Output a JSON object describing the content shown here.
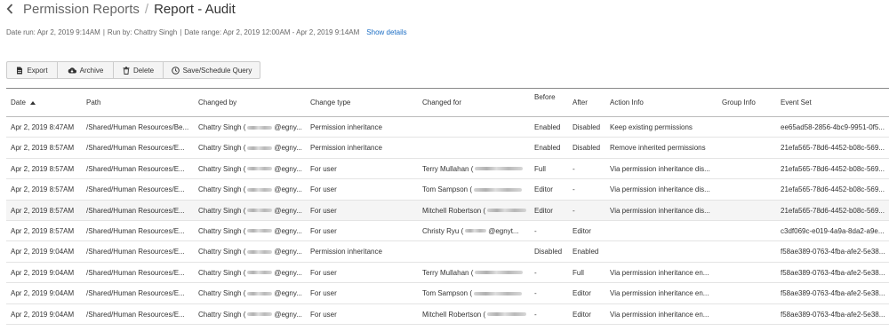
{
  "breadcrumb": {
    "parent": "Permission Reports",
    "separator": "/",
    "current": "Report - Audit"
  },
  "meta": {
    "date_run": "Date run: Apr 2, 2019 9:14AM",
    "run_by": "Run by: Chattry Singh",
    "date_range": "Date range: Apr 2, 2019 12:00AM - Apr 2, 2019 9:14AM",
    "separator": "|",
    "show_details": "Show details"
  },
  "toolbar": {
    "export": "Export",
    "archive": "Archive",
    "delete": "Delete",
    "schedule": "Save/Schedule Query"
  },
  "columns": {
    "date": "Date",
    "path": "Path",
    "changed_by": "Changed by",
    "change_type": "Change type",
    "changed_for": "Changed for",
    "before": "Before",
    "after": "After",
    "action_info": "Action Info",
    "group_info": "Group Info",
    "event_set": "Event Set"
  },
  "rows": [
    {
      "date": "Apr 2, 2019 8:47AM",
      "path": "/Shared/Human Resources/Be...",
      "changed_by_name": "Chattry Singh (",
      "changed_by_domain": "@egny...",
      "change_type": "Permission inheritance",
      "changed_for_name": "",
      "changed_for_domain": "",
      "before": "Enabled",
      "after": "Disabled",
      "action_info": "Keep existing permissions",
      "group_info": "",
      "event_set": "ee65ad58-2856-4bc9-9951-0f5..."
    },
    {
      "date": "Apr 2, 2019 8:57AM",
      "path": "/Shared/Human Resources/E...",
      "changed_by_name": "Chattry Singh (",
      "changed_by_domain": "@egny...",
      "change_type": "Permission inheritance",
      "changed_for_name": "",
      "changed_for_domain": "",
      "before": "Enabled",
      "after": "Disabled",
      "action_info": "Remove inherited permissions",
      "group_info": "",
      "event_set": "21efa565-78d6-4452-b08c-569..."
    },
    {
      "date": "Apr 2, 2019 8:57AM",
      "path": "/Shared/Human Resources/E...",
      "changed_by_name": "Chattry Singh (",
      "changed_by_domain": "@egny...",
      "change_type": "For user",
      "changed_for_name": "Terry Mullahan (",
      "changed_for_domain": "",
      "before": "Full",
      "after": "-",
      "action_info": "Via permission inheritance dis...",
      "group_info": "",
      "event_set": "21efa565-78d6-4452-b08c-569..."
    },
    {
      "date": "Apr 2, 2019 8:57AM",
      "path": "/Shared/Human Resources/E...",
      "changed_by_name": "Chattry Singh (",
      "changed_by_domain": "@egny...",
      "change_type": "For user",
      "changed_for_name": "Tom Sampson (",
      "changed_for_domain": "",
      "before": "Editor",
      "after": "-",
      "action_info": "Via permission inheritance dis...",
      "group_info": "",
      "event_set": "21efa565-78d6-4452-b08c-569..."
    },
    {
      "date": "Apr 2, 2019 8:57AM",
      "path": "/Shared/Human Resources/E...",
      "changed_by_name": "Chattry Singh (",
      "changed_by_domain": "@egny...",
      "change_type": "For user",
      "changed_for_name": "Mitchell Robertson (",
      "changed_for_domain": "",
      "before": "Editor",
      "after": "-",
      "action_info": "Via permission inheritance dis...",
      "group_info": "",
      "event_set": "21efa565-78d6-4452-b08c-569..."
    },
    {
      "date": "Apr 2, 2019 8:57AM",
      "path": "/Shared/Human Resources/E...",
      "changed_by_name": "Chattry Singh (",
      "changed_by_domain": "@egny...",
      "change_type": "For user",
      "changed_for_name": "Christy Ryu (",
      "changed_for_domain": "@egnyt...",
      "before": "-",
      "after": "Editor",
      "action_info": "",
      "group_info": "",
      "event_set": "c3df069c-e019-4a9a-8da2-a9e..."
    },
    {
      "date": "Apr 2, 2019 9:04AM",
      "path": "/Shared/Human Resources/E...",
      "changed_by_name": "Chattry Singh (",
      "changed_by_domain": "@egny...",
      "change_type": "Permission inheritance",
      "changed_for_name": "",
      "changed_for_domain": "",
      "before": "Disabled",
      "after": "Enabled",
      "action_info": "",
      "group_info": "",
      "event_set": "f58ae389-0763-4fba-afe2-5e38..."
    },
    {
      "date": "Apr 2, 2019 9:04AM",
      "path": "/Shared/Human Resources/E...",
      "changed_by_name": "Chattry Singh (",
      "changed_by_domain": "@egny...",
      "change_type": "For user",
      "changed_for_name": "Terry Mullahan (",
      "changed_for_domain": "",
      "before": "-",
      "after": "Full",
      "action_info": "Via permission inheritance en...",
      "group_info": "",
      "event_set": "f58ae389-0763-4fba-afe2-5e38..."
    },
    {
      "date": "Apr 2, 2019 9:04AM",
      "path": "/Shared/Human Resources/E...",
      "changed_by_name": "Chattry Singh (",
      "changed_by_domain": "@egny...",
      "change_type": "For user",
      "changed_for_name": "Tom Sampson (",
      "changed_for_domain": "",
      "before": "-",
      "after": "Editor",
      "action_info": "Via permission inheritance en...",
      "group_info": "",
      "event_set": "f58ae389-0763-4fba-afe2-5e38..."
    },
    {
      "date": "Apr 2, 2019 9:04AM",
      "path": "/Shared/Human Resources/E...",
      "changed_by_name": "Chattry Singh (",
      "changed_by_domain": "@egny...",
      "change_type": "For user",
      "changed_for_name": "Mitchell Robertson (",
      "changed_for_domain": "",
      "before": "-",
      "after": "Editor",
      "action_info": "Via permission inheritance en...",
      "group_info": "",
      "event_set": "f58ae389-0763-4fba-afe2-5e38..."
    }
  ],
  "icons": {
    "back": "chevron-left-icon",
    "export": "file-export-icon",
    "archive": "cloud-archive-icon",
    "delete": "trash-icon",
    "schedule": "clock-icon",
    "sort": "sort-ascending-icon"
  },
  "colors": {
    "link": "#1a6dc4",
    "text": "#333333",
    "muted": "#666666",
    "row_alt": "#f5f5f5"
  }
}
